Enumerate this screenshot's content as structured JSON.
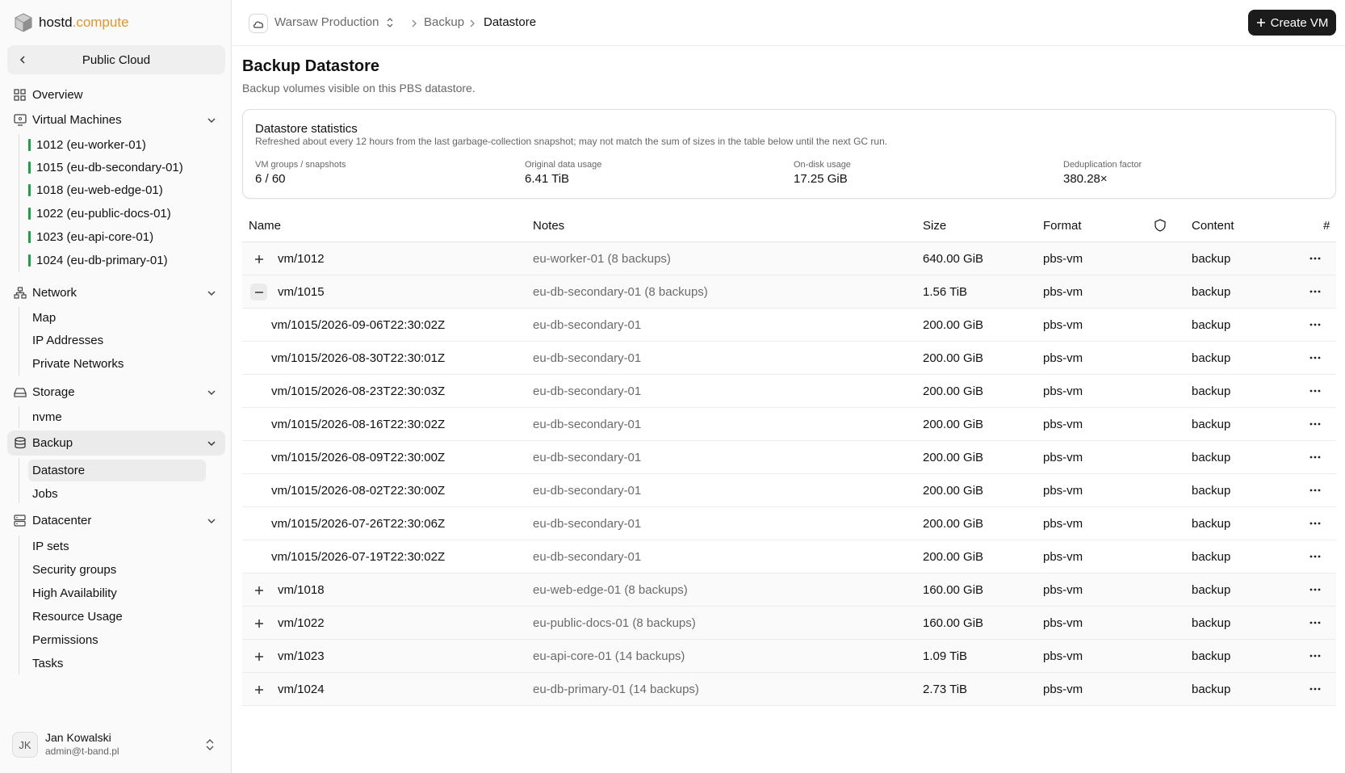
{
  "brand": {
    "part1": "hostd",
    "part2": ".compute"
  },
  "sidebar": {
    "context": "Public Cloud",
    "overview": "Overview",
    "vms": {
      "label": "Virtual Machines",
      "items": [
        "1012 (eu-worker-01)",
        "1015 (eu-db-secondary-01)",
        "1018 (eu-web-edge-01)",
        "1022 (eu-public-docs-01)",
        "1023 (eu-api-core-01)",
        "1024 (eu-db-primary-01)"
      ]
    },
    "network": {
      "label": "Network",
      "items": [
        "Map",
        "IP Addresses",
        "Private Networks"
      ]
    },
    "storage": {
      "label": "Storage",
      "items": [
        "nvme"
      ]
    },
    "backup": {
      "label": "Backup",
      "items": [
        "Datastore",
        "Jobs"
      ]
    },
    "datacenter": {
      "label": "Datacenter",
      "items": [
        "IP sets",
        "Security groups",
        "High Availability",
        "Resource Usage",
        "Permissions",
        "Tasks"
      ]
    },
    "user": {
      "initials": "JK",
      "name": "Jan Kowalski",
      "email": "admin@t-band.pl"
    }
  },
  "topbar": {
    "cluster": "Warsaw Production",
    "crumbs": [
      "Backup",
      "Datastore"
    ],
    "create_button": "Create VM"
  },
  "page": {
    "title": "Backup Datastore",
    "subtitle": "Backup volumes visible on this PBS datastore."
  },
  "stats": {
    "title": "Datastore statistics",
    "description": "Refreshed about every 12 hours from the last garbage-collection snapshot; may not match the sum of sizes in the table below until the next GC run.",
    "items": [
      {
        "label": "VM groups / snapshots",
        "value": "6 / 60"
      },
      {
        "label": "Original data usage",
        "value": "6.41 TiB"
      },
      {
        "label": "On-disk usage",
        "value": "17.25 GiB"
      },
      {
        "label": "Deduplication factor",
        "value": "380.28×"
      }
    ]
  },
  "table": {
    "headers": {
      "name": "Name",
      "notes": "Notes",
      "size": "Size",
      "format": "Format",
      "content": "Content",
      "count": "#"
    },
    "rows": [
      {
        "kind": "group",
        "expanded": false,
        "name": "vm/1012",
        "notes": "eu-worker-01 (8 backups)",
        "size": "640.00 GiB",
        "format": "pbs-vm",
        "content": "backup"
      },
      {
        "kind": "group",
        "expanded": true,
        "name": "vm/1015",
        "notes": "eu-db-secondary-01 (8 backups)",
        "size": "1.56 TiB",
        "format": "pbs-vm",
        "content": "backup"
      },
      {
        "kind": "child",
        "name": "vm/1015/2026-09-06T22:30:02Z",
        "notes": "eu-db-secondary-01",
        "size": "200.00 GiB",
        "format": "pbs-vm",
        "content": "backup"
      },
      {
        "kind": "child",
        "name": "vm/1015/2026-08-30T22:30:01Z",
        "notes": "eu-db-secondary-01",
        "size": "200.00 GiB",
        "format": "pbs-vm",
        "content": "backup"
      },
      {
        "kind": "child",
        "name": "vm/1015/2026-08-23T22:30:03Z",
        "notes": "eu-db-secondary-01",
        "size": "200.00 GiB",
        "format": "pbs-vm",
        "content": "backup"
      },
      {
        "kind": "child",
        "name": "vm/1015/2026-08-16T22:30:02Z",
        "notes": "eu-db-secondary-01",
        "size": "200.00 GiB",
        "format": "pbs-vm",
        "content": "backup"
      },
      {
        "kind": "child",
        "name": "vm/1015/2026-08-09T22:30:00Z",
        "notes": "eu-db-secondary-01",
        "size": "200.00 GiB",
        "format": "pbs-vm",
        "content": "backup"
      },
      {
        "kind": "child",
        "name": "vm/1015/2026-08-02T22:30:00Z",
        "notes": "eu-db-secondary-01",
        "size": "200.00 GiB",
        "format": "pbs-vm",
        "content": "backup"
      },
      {
        "kind": "child",
        "name": "vm/1015/2026-07-26T22:30:06Z",
        "notes": "eu-db-secondary-01",
        "size": "200.00 GiB",
        "format": "pbs-vm",
        "content": "backup"
      },
      {
        "kind": "child",
        "name": "vm/1015/2026-07-19T22:30:02Z",
        "notes": "eu-db-secondary-01",
        "size": "200.00 GiB",
        "format": "pbs-vm",
        "content": "backup"
      },
      {
        "kind": "group",
        "expanded": false,
        "name": "vm/1018",
        "notes": "eu-web-edge-01 (8 backups)",
        "size": "160.00 GiB",
        "format": "pbs-vm",
        "content": "backup"
      },
      {
        "kind": "group",
        "expanded": false,
        "name": "vm/1022",
        "notes": "eu-public-docs-01 (8 backups)",
        "size": "160.00 GiB",
        "format": "pbs-vm",
        "content": "backup"
      },
      {
        "kind": "group",
        "expanded": false,
        "name": "vm/1023",
        "notes": "eu-api-core-01 (14 backups)",
        "size": "1.09 TiB",
        "format": "pbs-vm",
        "content": "backup"
      },
      {
        "kind": "group",
        "expanded": false,
        "name": "vm/1024",
        "notes": "eu-db-primary-01 (14 backups)",
        "size": "2.73 TiB",
        "format": "pbs-vm",
        "content": "backup"
      }
    ]
  },
  "colors": {
    "brand_accent": "#e0952e",
    "vm_status": "#1e9e4a",
    "primary_button": "#1b1b1b"
  }
}
